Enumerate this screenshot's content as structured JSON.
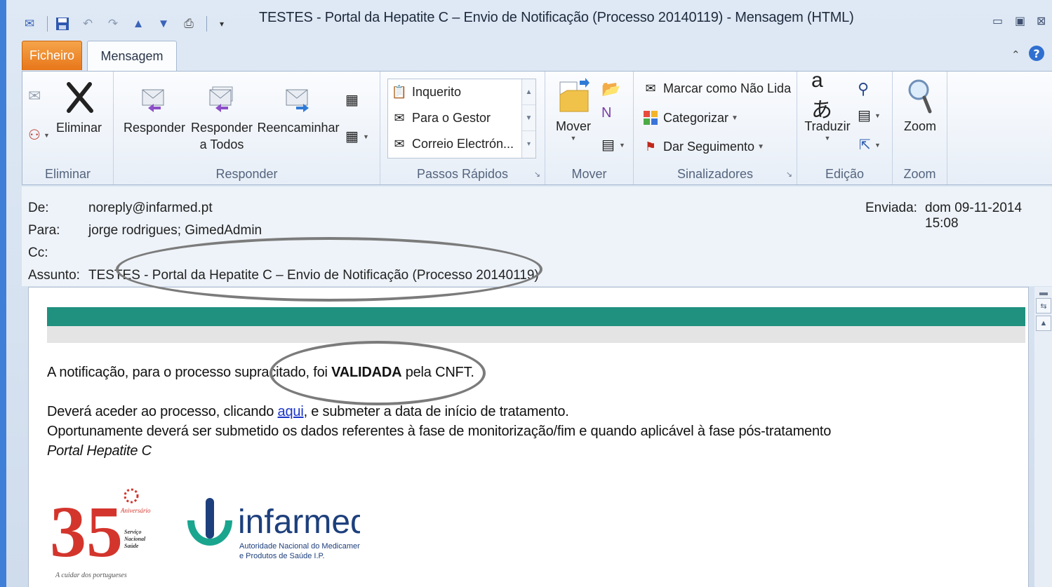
{
  "window": {
    "title": "TESTES - Portal da Hepatite C – Envio de Notificação (Processo 20140119)  -  Mensagem (HTML)"
  },
  "tabs": {
    "file": "Ficheiro",
    "message": "Mensagem"
  },
  "ribbon": {
    "eliminar_group": {
      "label": "Eliminar",
      "delete_button": "Eliminar"
    },
    "responder_group": {
      "label": "Responder",
      "reply": "Responder",
      "reply_all_line1": "Responder",
      "reply_all_line2": "a Todos",
      "forward": "Reencaminhar"
    },
    "quick_steps_group": {
      "label": "Passos Rápidos",
      "items": [
        "Inquerito",
        "Para o Gestor",
        "Correio Electrón..."
      ]
    },
    "mover_group": {
      "label": "Mover",
      "move_button": "Mover"
    },
    "sinalizadores_group": {
      "label": "Sinalizadores",
      "mark_unread": "Marcar como Não Lida",
      "categorize": "Categorizar",
      "follow_up": "Dar Seguimento"
    },
    "edicao_group": {
      "label": "Edição",
      "translate": "Traduzir"
    },
    "zoom_group": {
      "label": "Zoom",
      "zoom_button": "Zoom"
    }
  },
  "header": {
    "from_label": "De:",
    "from_value": "noreply@infarmed.pt",
    "to_label": "Para:",
    "to_value": "jorge rodrigues; GimedAdmin",
    "cc_label": "Cc:",
    "cc_value": "",
    "subject_label": "Assunto:",
    "subject_value": "TESTES - Portal da Hepatite C – Envio de Notificação (Processo 20140119)",
    "sent_label": "Enviada:",
    "sent_value": "dom 09-11-2014 15:08"
  },
  "body": {
    "line1_pre": "A notificação, para o processo supracitado, foi ",
    "line1_bold": "VALIDADA",
    "line1_post": " pela CNFT.",
    "line2_pre": "Deverá aceder ao processo, clicando ",
    "line2_link": "aqui",
    "line2_post": ", e submeter a data de início de tratamento.",
    "line3": "Oportunamente deverá ser submetido os dados referentes à fase de monitorização/fim e quando aplicável à fase pós-tratamento",
    "signature": "Portal Hepatite C"
  },
  "logos": {
    "sns_number": "35",
    "sns_text1": "Aniversário",
    "sns_text2": "Serviço",
    "sns_text3": "Nacional",
    "sns_text4": "Saúde",
    "sns_tagline": "A cuidar dos portugueses",
    "infarmed_name": "infarmed",
    "infarmed_sub1": "Autoridade Nacional do Medicamento",
    "infarmed_sub2": "e Produtos de Saúde I.P."
  },
  "colors": {
    "accent_green": "#20907f",
    "file_tab": "#e8761a",
    "link": "#1b35c8"
  }
}
